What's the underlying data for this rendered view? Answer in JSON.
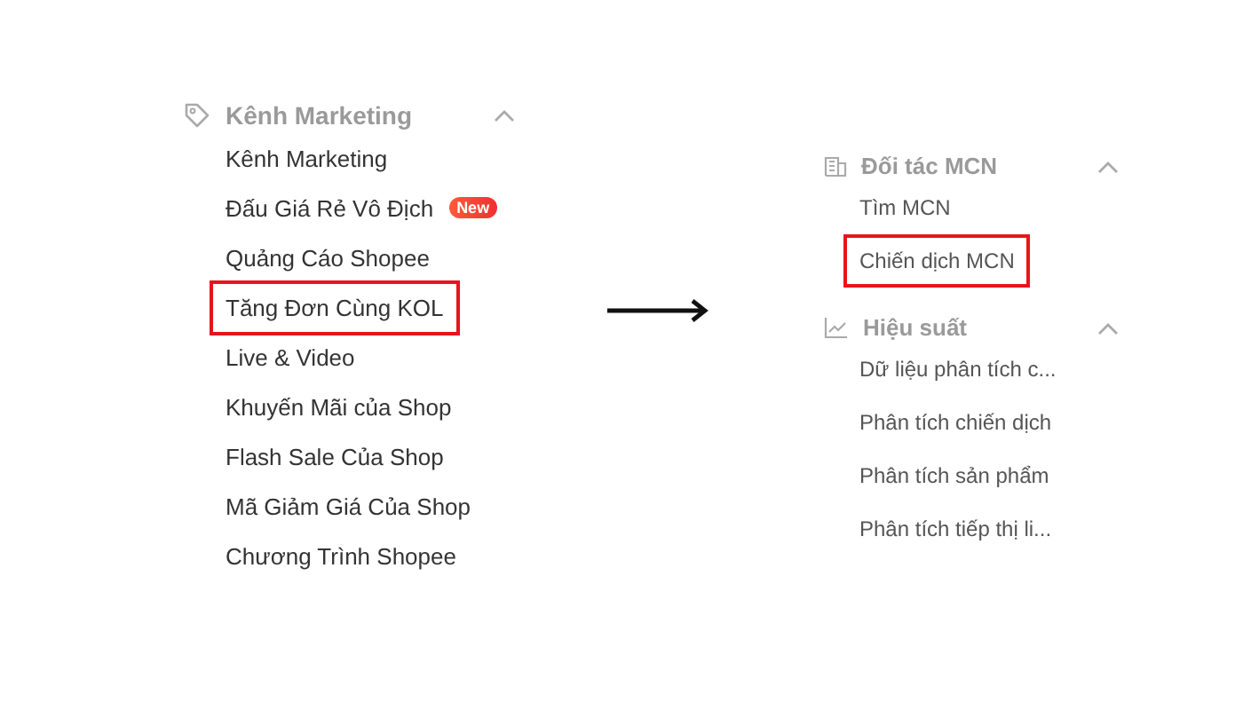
{
  "left_menu": {
    "header": {
      "label": "Kênh Marketing",
      "kind": "tag",
      "expanded": true
    },
    "items": [
      {
        "label": "Kênh Marketing",
        "highlighted": false
      },
      {
        "label": "Đấu Giá Rẻ Vô Địch",
        "highlighted": false,
        "badge": "New"
      },
      {
        "label": "Quảng Cáo Shopee",
        "highlighted": false
      },
      {
        "label": "Tăng Đơn Cùng KOL",
        "highlighted": true
      },
      {
        "label": "Live & Video",
        "highlighted": false
      },
      {
        "label": "Khuyến Mãi của Shop",
        "highlighted": false
      },
      {
        "label": "Flash Sale Của Shop",
        "highlighted": false
      },
      {
        "label": "Mã Giảm Giá Của Shop",
        "highlighted": false
      },
      {
        "label": "Chương Trình Shopee",
        "highlighted": false
      }
    ]
  },
  "right_menu": {
    "sections": [
      {
        "header": {
          "label": "Đối tác MCN",
          "kind": "building",
          "expanded": true
        },
        "items": [
          {
            "label": "Tìm MCN",
            "highlighted": false
          },
          {
            "label": "Chiến dịch MCN",
            "highlighted": true
          }
        ]
      },
      {
        "header": {
          "label": "Hiệu suất",
          "kind": "chart",
          "expanded": true
        },
        "items": [
          {
            "label": "Dữ liệu phân tích c...",
            "highlighted": false
          },
          {
            "label": "Phân tích chiến dịch",
            "highlighted": false
          },
          {
            "label": "Phân tích sản phẩm",
            "highlighted": false
          },
          {
            "label": "Phân tích tiếp thị li...",
            "highlighted": false
          }
        ]
      }
    ]
  }
}
